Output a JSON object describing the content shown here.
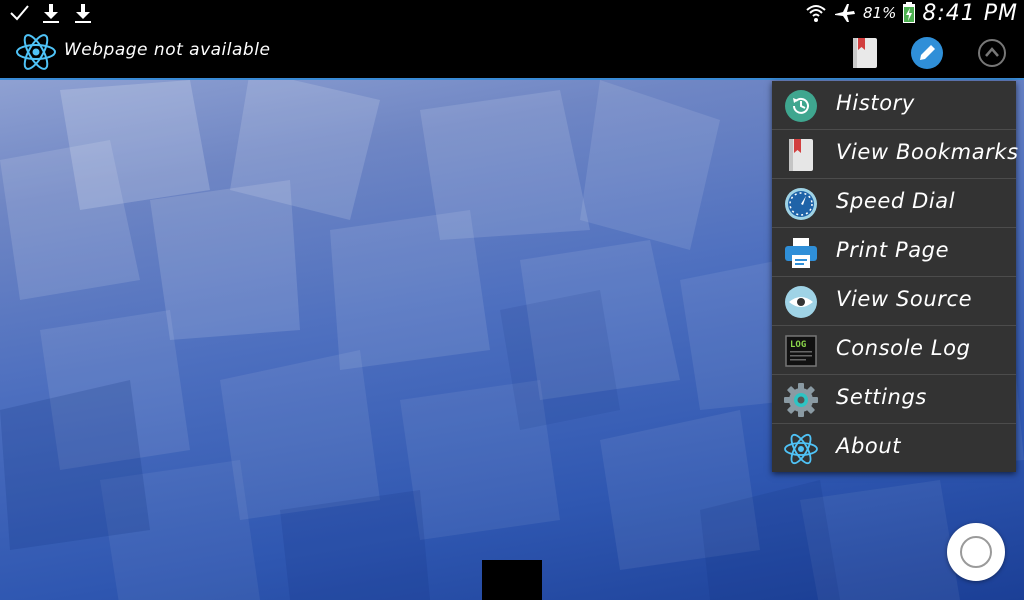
{
  "status_bar": {
    "left_icons": [
      "check-icon",
      "download-icon",
      "download-icon"
    ],
    "right_icons": [
      "wifi-icon",
      "airplane-icon",
      "battery-charging-icon"
    ],
    "battery_percent": "81%",
    "time": "8:41 PM"
  },
  "action_bar": {
    "title": "Webpage not available",
    "buttons": [
      "bookmark-icon",
      "edit-icon",
      "collapse-icon"
    ]
  },
  "menu": {
    "items": [
      {
        "label": "History",
        "icon": "history-icon"
      },
      {
        "label": "View Bookmarks",
        "icon": "bookmark-icon"
      },
      {
        "label": "Speed Dial",
        "icon": "speed-dial-icon"
      },
      {
        "label": "Print Page",
        "icon": "printer-icon"
      },
      {
        "label": "View Source",
        "icon": "eye-icon"
      },
      {
        "label": "Console Log",
        "icon": "log-icon"
      },
      {
        "label": "Settings",
        "icon": "gear-icon"
      },
      {
        "label": "About",
        "icon": "atom-icon"
      }
    ],
    "log_icon_text": "LOG"
  },
  "colors": {
    "accent": "#3a8bd6",
    "menu_bg": "#333333",
    "history_icon": "#3fa68f",
    "bookmark_icon": "#d23f3f",
    "printer_icon": "#2f8fd8",
    "atom_icon": "#4fc3f7"
  }
}
